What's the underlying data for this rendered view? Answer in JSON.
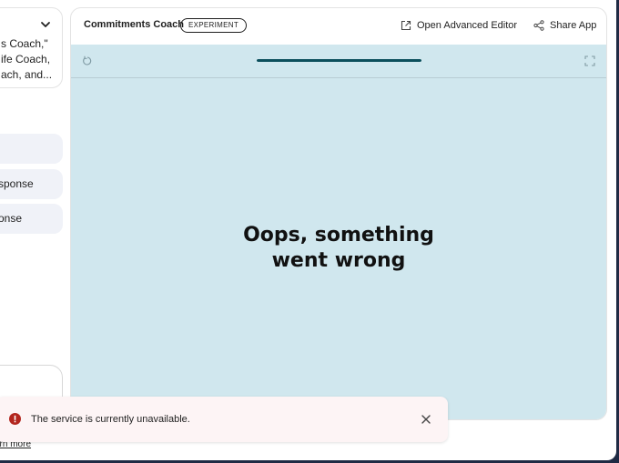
{
  "left_panel": {
    "description_lines": [
      "s Coach,\"",
      "ife Coach,",
      "ach, and..."
    ],
    "chips": [
      {
        "label": ""
      },
      {
        "label": "sponse"
      },
      {
        "label": "onse"
      }
    ],
    "learn_more": "arn more"
  },
  "app": {
    "title": "Commitments Coach",
    "badge": "EXPERIMENT",
    "open_editor_label": "Open Advanced Editor",
    "share_label": "Share App"
  },
  "preview": {
    "progress_fraction": 1.0,
    "error_line1": "Oops, something",
    "error_line2": "went wrong",
    "background": "#d0e7ee",
    "progress_color": "#0b4f5c"
  },
  "toast": {
    "message": "The service is currently unavailable.",
    "icon": "error-icon",
    "icon_color": "#b3261e"
  }
}
